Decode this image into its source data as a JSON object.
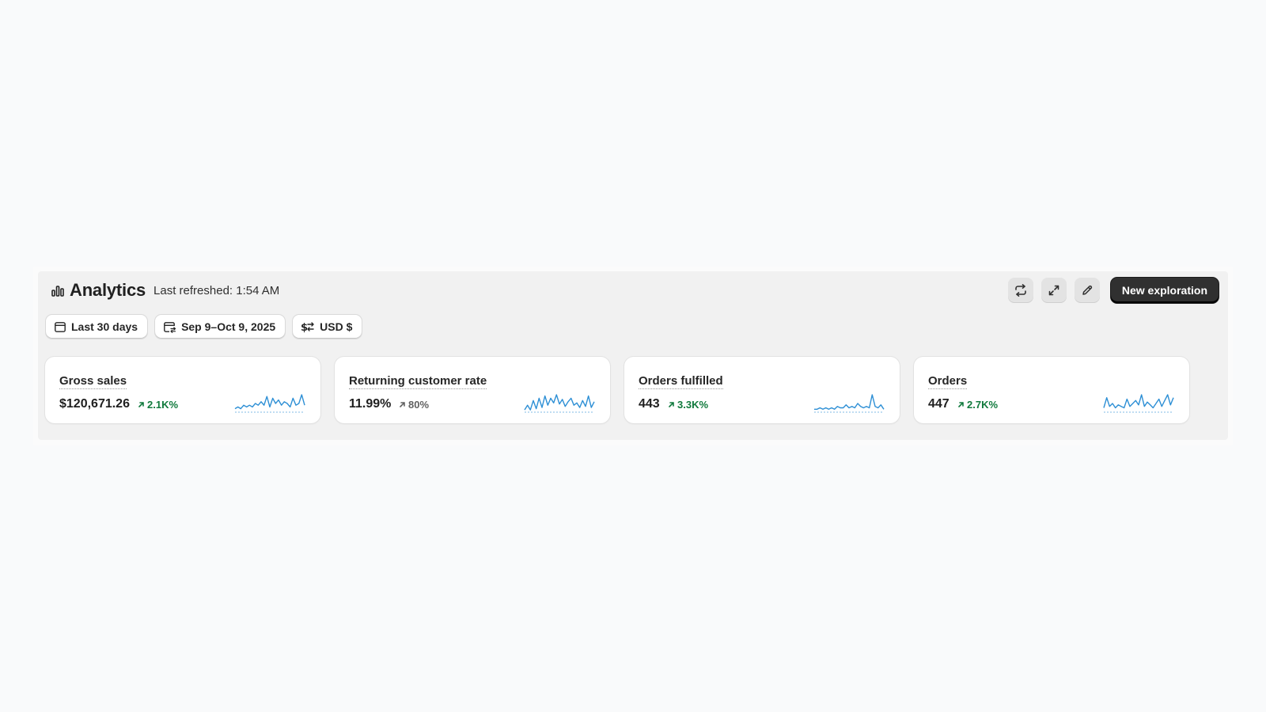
{
  "header": {
    "title": "Analytics",
    "refreshed": "Last refreshed: 1:54 AM",
    "new_exploration_label": "New exploration"
  },
  "filters": {
    "range": "Last 30 days",
    "dates": "Sep 9–Oct 9, 2025",
    "currency": "USD $"
  },
  "colors": {
    "positive": "#117a3d",
    "neutral": "#616161",
    "spark_line": "#2d8fd5"
  },
  "cards": [
    {
      "label": "Gross sales",
      "value": "$120,671.26",
      "delta": "2.1K%",
      "trend": "positive",
      "spark": [
        2,
        3,
        2,
        4,
        3,
        4,
        3,
        5,
        4,
        6,
        4,
        9,
        3,
        8,
        5,
        7,
        4,
        6,
        5,
        3,
        8,
        4,
        5,
        10,
        4
      ]
    },
    {
      "label": "Returning customer rate",
      "value": "11.99%",
      "delta": "80%",
      "trend": "neutral",
      "spark": [
        2,
        6,
        2,
        10,
        3,
        12,
        4,
        14,
        6,
        12,
        8,
        15,
        7,
        11,
        5,
        9,
        12,
        6,
        8,
        4,
        10,
        5,
        14,
        4,
        9
      ]
    },
    {
      "label": "Orders fulfilled",
      "value": "443",
      "delta": "3.3K%",
      "trend": "positive",
      "spark": [
        2,
        2,
        3,
        2,
        3,
        2,
        3,
        2,
        4,
        3,
        3,
        5,
        3,
        4,
        3,
        6,
        4,
        3,
        4,
        3,
        12,
        4,
        3,
        5,
        2
      ]
    },
    {
      "label": "Orders",
      "value": "447",
      "delta": "2.7K%",
      "trend": "positive",
      "spark": [
        3,
        10,
        4,
        6,
        3,
        5,
        4,
        3,
        9,
        4,
        6,
        8,
        5,
        12,
        4,
        7,
        5,
        3,
        6,
        9,
        4,
        8,
        12,
        5,
        10
      ]
    }
  ]
}
